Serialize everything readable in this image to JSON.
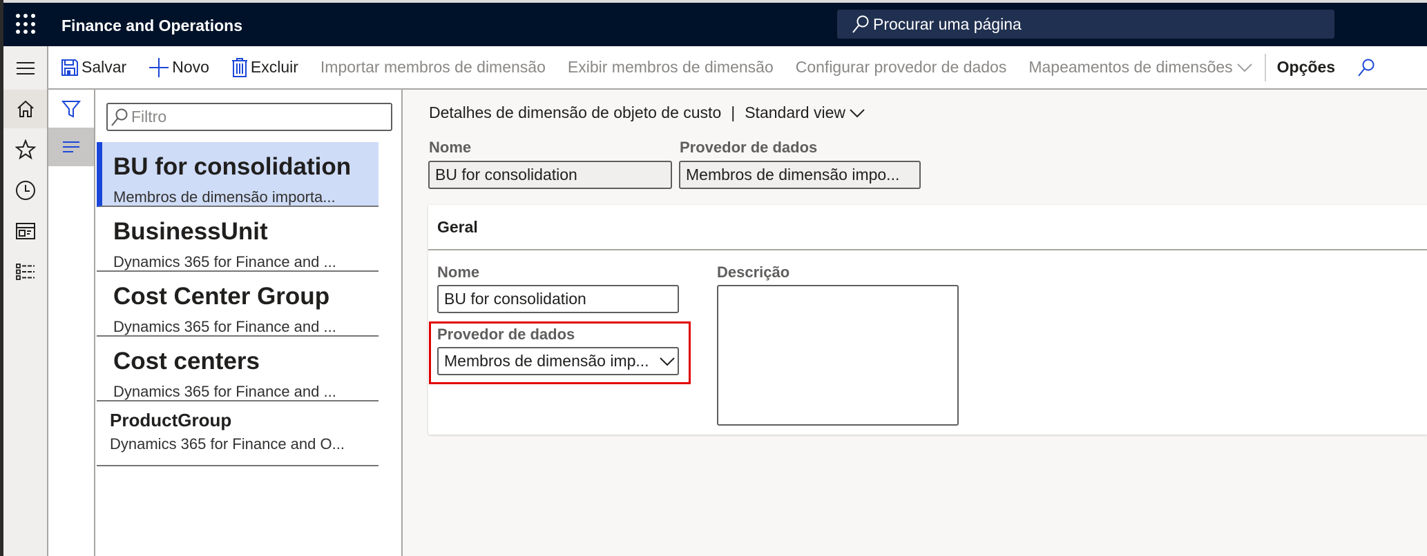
{
  "header": {
    "app_title": "Finance and Operations",
    "search_placeholder": "Procurar uma página"
  },
  "toolbar": {
    "save": "Salvar",
    "new": "Novo",
    "delete": "Excluir",
    "import_members": "Importar membros de dimensão",
    "view_members": "Exibir membros de dimensão",
    "configure_provider": "Configurar provedor de dados",
    "dimension_mappings": "Mapeamentos de dimensões",
    "options": "Opções"
  },
  "nav_rail": {
    "items": [
      "menu-icon",
      "home-icon",
      "star-icon",
      "clock-icon",
      "workspace-icon",
      "list-icon"
    ]
  },
  "list": {
    "filter_placeholder": "Filtro",
    "items": [
      {
        "title": "BU for consolidation",
        "subtitle": "Membros de dimensão importa...",
        "selected": true
      },
      {
        "title": "BusinessUnit",
        "subtitle": "Dynamics 365 for Finance and ..."
      },
      {
        "title": "Cost Center Group",
        "subtitle": "Dynamics 365 for Finance and ..."
      },
      {
        "title": "Cost centers",
        "subtitle": "Dynamics 365 for Finance and ..."
      },
      {
        "title": "ProductGroup",
        "subtitle": "Dynamics 365 for Finance and O..."
      }
    ]
  },
  "main": {
    "breadcrumb": "Detalhes de dimensão de objeto de custo",
    "separator": "|",
    "view": "Standard view",
    "header_fields": {
      "name_label": "Nome",
      "name_value": "BU for consolidation",
      "provider_label": "Provedor de dados",
      "provider_value": "Membros de dimensão impo..."
    },
    "fasttab": {
      "title": "Geral",
      "name_label": "Nome",
      "name_value": "BU for consolidation",
      "provider_label": "Provedor de dados",
      "provider_value": "Membros de dimensão imp...",
      "description_label": "Descrição",
      "description_value": ""
    }
  },
  "colors": {
    "header_bg": "#001229",
    "accent": "#1a47d8",
    "selected_bg": "#cfdcf7",
    "highlight": "#e00000"
  }
}
